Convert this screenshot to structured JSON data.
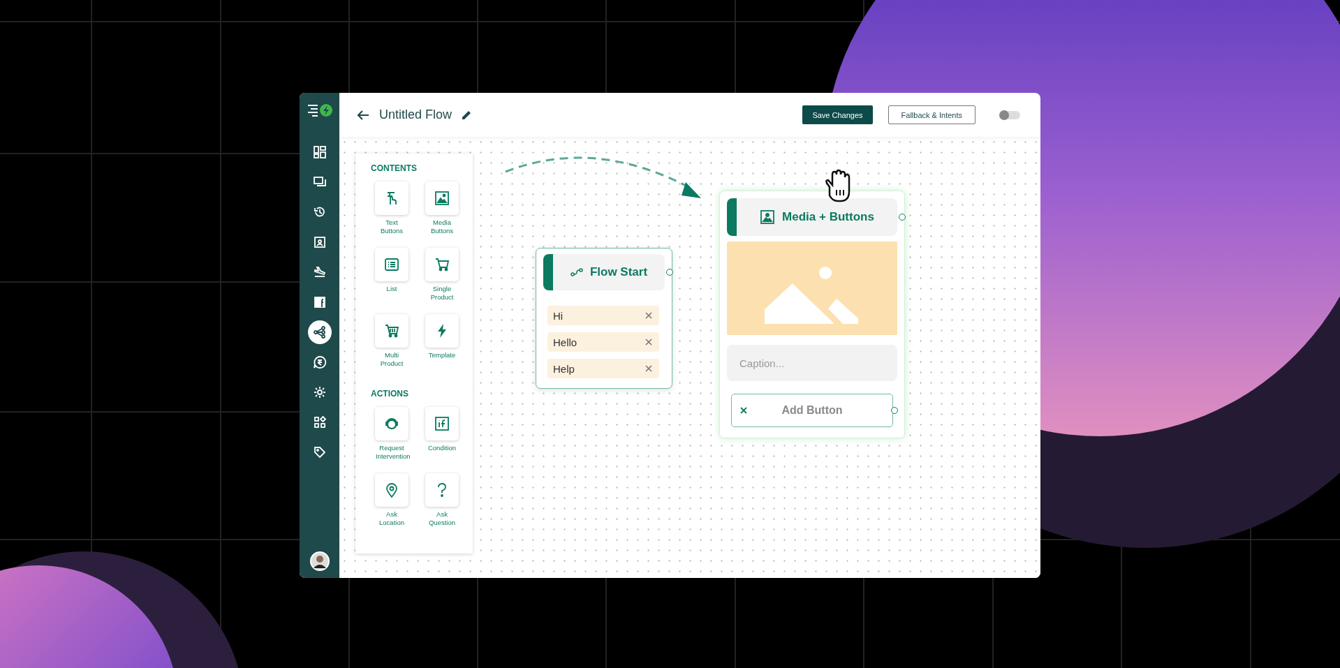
{
  "header": {
    "title": "Untitled Flow",
    "buttons": [
      {
        "label": "Save Changes",
        "kind": "primary"
      },
      {
        "label": "Fallback & Intents",
        "kind": "outline"
      }
    ],
    "toggle": {
      "on": false
    }
  },
  "sidebar": {
    "items": [
      {
        "selected": false
      },
      {
        "selected": false
      },
      {
        "selected": false
      },
      {
        "selected": false
      },
      {
        "selected": false
      },
      {
        "selected": false
      },
      {
        "selected": true
      },
      {
        "selected": false
      },
      {
        "selected": false
      },
      {
        "selected": false
      },
      {
        "selected": false
      }
    ]
  },
  "palette": {
    "sections": [
      {
        "title": "CONTENTS",
        "items": [
          {
            "label": "Text Buttons"
          },
          {
            "label": "Media Buttons"
          },
          {
            "label": "List"
          },
          {
            "label": "Single Product"
          },
          {
            "label": "Multi Product"
          },
          {
            "label": "Template"
          }
        ]
      },
      {
        "title": "ACTIONS",
        "items": [
          {
            "label": "Request Intervention"
          },
          {
            "label": "Condition"
          },
          {
            "label": "Ask Location"
          },
          {
            "label": "Ask Question"
          }
        ]
      }
    ]
  },
  "flow_start": {
    "title": "Flow Start",
    "keywords": [
      "Hi",
      "Hello",
      "Help"
    ]
  },
  "media_node": {
    "title": "Media + Buttons",
    "caption_placeholder": "Caption...",
    "button_label": "Add Button"
  }
}
